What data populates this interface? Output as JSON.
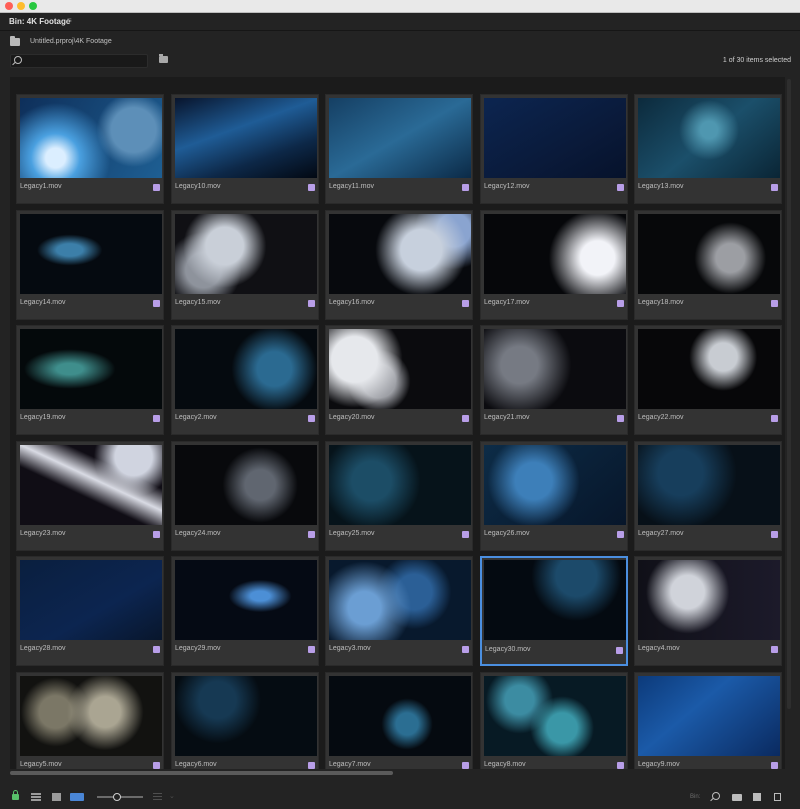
{
  "panel": {
    "title": "Bin: 4K Footage",
    "menu_glyph": "≡",
    "path": "Untitled.prproj\\4K Footage",
    "search_value": "",
    "selection_count": "1 of 30 items selected"
  },
  "footer": {
    "bin_label": "Bin:"
  },
  "items": [
    {
      "label": "Legacy1.mov",
      "selected": false
    },
    {
      "label": "Legacy10.mov",
      "selected": false
    },
    {
      "label": "Legacy11.mov",
      "selected": false
    },
    {
      "label": "Legacy12.mov",
      "selected": false
    },
    {
      "label": "Legacy13.mov",
      "selected": false
    },
    {
      "label": "Legacy14.mov",
      "selected": false
    },
    {
      "label": "Legacy15.mov",
      "selected": false
    },
    {
      "label": "Legacy16.mov",
      "selected": false
    },
    {
      "label": "Legacy17.mov",
      "selected": false
    },
    {
      "label": "Legacy18.mov",
      "selected": false
    },
    {
      "label": "Legacy19.mov",
      "selected": false
    },
    {
      "label": "Legacy2.mov",
      "selected": false
    },
    {
      "label": "Legacy20.mov",
      "selected": false
    },
    {
      "label": "Legacy21.mov",
      "selected": false
    },
    {
      "label": "Legacy22.mov",
      "selected": false
    },
    {
      "label": "Legacy23.mov",
      "selected": false
    },
    {
      "label": "Legacy24.mov",
      "selected": false
    },
    {
      "label": "Legacy25.mov",
      "selected": false
    },
    {
      "label": "Legacy26.mov",
      "selected": false
    },
    {
      "label": "Legacy27.mov",
      "selected": false
    },
    {
      "label": "Legacy28.mov",
      "selected": false
    },
    {
      "label": "Legacy29.mov",
      "selected": false
    },
    {
      "label": "Legacy3.mov",
      "selected": false
    },
    {
      "label": "Legacy30.mov",
      "selected": true
    },
    {
      "label": "Legacy4.mov",
      "selected": false
    },
    {
      "label": "Legacy5.mov",
      "selected": false
    },
    {
      "label": "Legacy6.mov",
      "selected": false
    },
    {
      "label": "Legacy7.mov",
      "selected": false
    },
    {
      "label": "Legacy8.mov",
      "selected": false
    },
    {
      "label": "Legacy9.mov",
      "selected": false
    }
  ],
  "colors": {
    "badge": "#b89ee8",
    "selection": "#4b8fe0"
  }
}
